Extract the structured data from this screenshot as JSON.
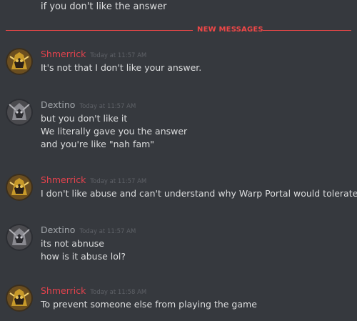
{
  "continuation_text": "if you don't like the answer",
  "divider_label": "NEW MESSAGES",
  "messages": [
    {
      "author": "Shmerrick",
      "timestamp": "Today at 11:57 AM",
      "lines": [
        "It's not that I don't like your answer."
      ]
    },
    {
      "author": "Dextino",
      "timestamp": "Today at 11:57 AM",
      "lines": [
        "but you don't like it",
        "We literally gave you the answer",
        "and you're like \"nah fam\""
      ]
    },
    {
      "author": "Shmerrick",
      "timestamp": "Today at 11:57 AM",
      "lines": [
        "I don't like abuse and can't understand why Warp Portal would tolerate abuse."
      ]
    },
    {
      "author": "Dextino",
      "timestamp": "Today at 11:57 AM",
      "lines": [
        "its not abnuse",
        "how is it abuse lol?"
      ]
    },
    {
      "author": "Shmerrick",
      "timestamp": "Today at 11:58 AM",
      "lines": [
        "To prevent someone else from playing the game"
      ]
    }
  ],
  "colors": {
    "background": "#36393e",
    "shmerrick_name": "#e3424d",
    "dextino_name": "#a2a6ab",
    "divider": "#f04747"
  },
  "icons": {
    "shmerrick_avatar": "armored-knight-avatar-gold",
    "dextino_avatar": "armored-knight-avatar-gray"
  }
}
